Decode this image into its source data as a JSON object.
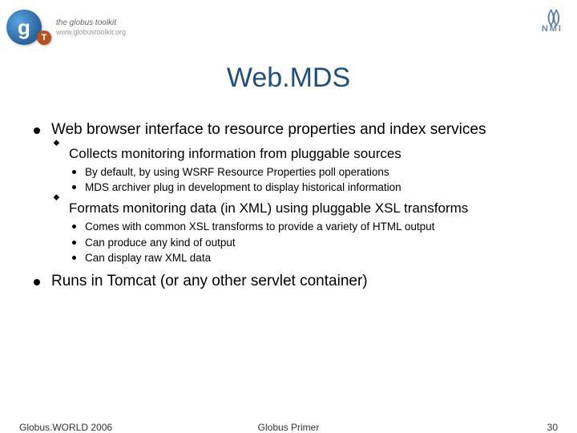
{
  "header": {
    "globus_letter": "g",
    "globus_t": "T",
    "toolkit_line1": "the globus toolkit",
    "toolkit_line2": "www.globustoolkit.org",
    "nmi_label": "NMI"
  },
  "title": "Web.MDS",
  "bullets": {
    "b1": "Web browser interface to resource properties and index services",
    "b1_1": "Collects monitoring information from pluggable sources",
    "b1_1_1": "By default, by using WSRF Resource Properties poll operations",
    "b1_1_2": "MDS archiver plug in development to display historical information",
    "b1_2": "Formats monitoring data (in XML) using pluggable XSL transforms",
    "b1_2_1": "Comes with common XSL transforms to provide a variety of HTML output",
    "b1_2_2": "Can produce any kind of output",
    "b1_2_3": "Can display raw XML data",
    "b2": "Runs in Tomcat (or any other servlet container)"
  },
  "footer": {
    "left": "Globus.WORLD 2006",
    "center": "Globus Primer",
    "page": "30"
  }
}
